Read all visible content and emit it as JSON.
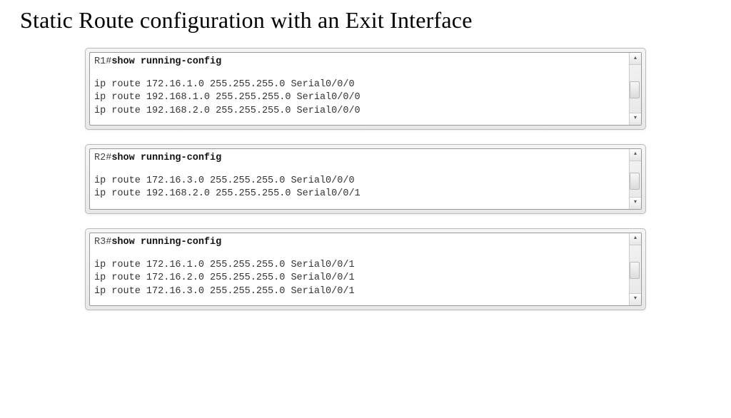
{
  "title": "Static Route configuration with an Exit Interface",
  "consoles": [
    {
      "prompt": "R1#",
      "command": "show running-config",
      "routes": [
        "ip route 172.16.1.0 255.255.255.0 Serial0/0/0",
        "ip route 192.168.1.0 255.255.255.0 Serial0/0/0",
        "ip route 192.168.2.0 255.255.255.0 Serial0/0/0"
      ]
    },
    {
      "prompt": "R2#",
      "command": "show running-config",
      "routes": [
        "ip route 172.16.3.0 255.255.255.0 Serial0/0/0",
        "ip route 192.168.2.0 255.255.255.0 Serial0/0/1"
      ]
    },
    {
      "prompt": "R3#",
      "command": "show running-config",
      "routes": [
        "ip route 172.16.1.0 255.255.255.0 Serial0/0/1",
        "ip route 172.16.2.0 255.255.255.0 Serial0/0/1",
        "ip route 172.16.3.0 255.255.255.0 Serial0/0/1"
      ]
    }
  ]
}
